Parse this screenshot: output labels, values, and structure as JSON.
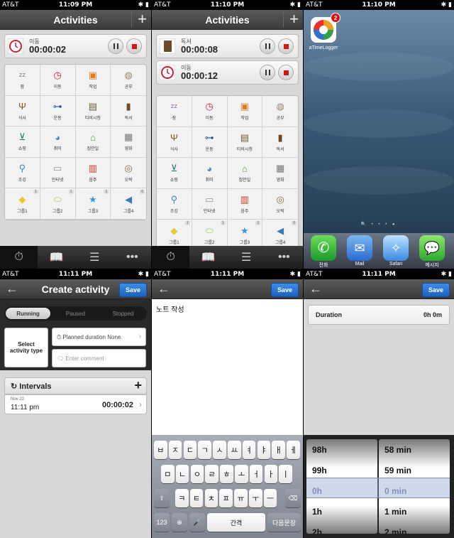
{
  "screens": {
    "s1": {
      "status": {
        "carrier": "AT&T",
        "time": "11:09 PM"
      },
      "title": "Activities",
      "plus": "+",
      "timers": [
        {
          "name": "이동",
          "value": "00:00:02"
        }
      ],
      "grid": [
        {
          "label": "잠",
          "icon": "sleep-icon",
          "color": "#8a6b9a"
        },
        {
          "label": "이동",
          "icon": "clock-icon",
          "color": "#c8243a"
        },
        {
          "label": "작업",
          "icon": "briefcase-icon",
          "color": "#e07a20"
        },
        {
          "label": "공부",
          "icon": "planet-icon",
          "color": "#9a8870"
        },
        {
          "label": "식사",
          "icon": "fork-icon",
          "color": "#7a5a20"
        },
        {
          "label": "운동",
          "icon": "dumbbell-icon",
          "color": "#2a5a9a"
        },
        {
          "label": "티비시청",
          "icon": "tv-icon",
          "color": "#6a5a3a"
        },
        {
          "label": "독서",
          "icon": "book-icon",
          "color": "#6a4a2a"
        },
        {
          "label": "쇼핑",
          "icon": "cart-icon",
          "color": "#2a6a6a"
        },
        {
          "label": "취미",
          "icon": "palette-icon",
          "color": "#4a8ac8"
        },
        {
          "label": "집안일",
          "icon": "house-icon",
          "color": "#5a9a4a"
        },
        {
          "label": "영화",
          "icon": "film-icon",
          "color": "#777777"
        },
        {
          "label": "조깅",
          "icon": "runner-icon",
          "color": "#3a8ab8"
        },
        {
          "label": "인터넷",
          "icon": "monitor-icon",
          "color": "#8a9aa8"
        },
        {
          "label": "음주",
          "icon": "beer-icon",
          "color": "#c83a2a"
        },
        {
          "label": "오락",
          "icon": "gamepad-icon",
          "color": "#8a6a4a"
        },
        {
          "label": "그룹1",
          "icon": "dice-icon",
          "color": "#e8c830",
          "count": "1"
        },
        {
          "label": "그룹2",
          "icon": "pill-icon",
          "color": "#8ac84a",
          "count": "1"
        },
        {
          "label": "그룹3",
          "icon": "star-icon",
          "color": "#3a9ad8",
          "count": "1"
        },
        {
          "label": "그룹4",
          "icon": "megaphone-icon",
          "color": "#3a7ab8",
          "count": "0"
        }
      ]
    },
    "s2": {
      "status": {
        "carrier": "AT&T",
        "time": "11:10 PM"
      },
      "title": "Activities",
      "plus": "+",
      "timers": [
        {
          "name": "독서",
          "value": "00:00:08"
        },
        {
          "name": "이동",
          "value": "00:00:12"
        }
      ]
    },
    "s3": {
      "status": {
        "carrier": "AT&T",
        "time": "11:10 PM"
      },
      "app_name": "aTimeLogger",
      "badge": "2",
      "dock": [
        "전화",
        "Mail",
        "Safari",
        "메시지"
      ]
    },
    "s4": {
      "status": {
        "carrier": "AT&T",
        "time": "11:11 PM"
      },
      "title": "Create activity",
      "save": "Save",
      "segments": [
        "Running",
        "Paused",
        "Stopped"
      ],
      "select_type": "Select activity type",
      "planned_label": "Planned duration",
      "planned_value": "None",
      "comment_placeholder": "Enter comment",
      "intervals_title": "Intervals",
      "interval_date": "Nov 22",
      "interval_time": "11:11 pm",
      "interval_duration": "00:00:02"
    },
    "s5": {
      "status": {
        "carrier": "AT&T",
        "time": "11:11 PM"
      },
      "save": "Save",
      "note": "노트 작성",
      "keys_row1": [
        "ㅂ",
        "ㅈ",
        "ㄷ",
        "ㄱ",
        "ㅅ",
        "ㅛ",
        "ㅕ",
        "ㅑ",
        "ㅐ",
        "ㅔ"
      ],
      "keys_row2": [
        "ㅁ",
        "ㄴ",
        "ㅇ",
        "ㄹ",
        "ㅎ",
        "ㅗ",
        "ㅓ",
        "ㅏ",
        "ㅣ"
      ],
      "keys_row3": [
        "ㅋ",
        "ㅌ",
        "ㅊ",
        "ㅍ",
        "ㅠ",
        "ㅜ",
        "ㅡ"
      ],
      "key_123": "123",
      "key_space": "간격",
      "key_return": "다음문장"
    },
    "s6": {
      "status": {
        "carrier": "AT&T",
        "time": "11:11 PM"
      },
      "save": "Save",
      "duration_label": "Duration",
      "duration_value": "0h 0m",
      "hours": [
        "98h",
        "99h",
        "0h",
        "1h",
        "2h"
      ],
      "mins": [
        "58 min",
        "59 min",
        "0 min",
        "1 min",
        "2 min"
      ]
    }
  }
}
